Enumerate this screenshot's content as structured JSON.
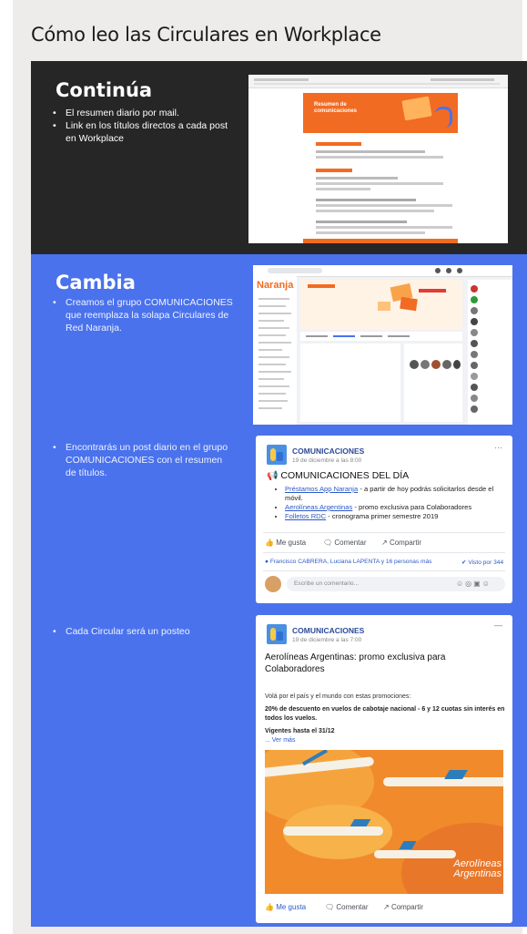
{
  "title": "Cómo leo las Circulares en Workplace",
  "section1": {
    "heading": "Continúa",
    "bullets": [
      "El resumen diario por mail.",
      "Link en los títulos directos a cada post en Workplace"
    ]
  },
  "section2": {
    "heading": "Cambia",
    "bullets": [
      "Creamos el grupo COMUNICACIONES que reemplaza la solapa Circulares de Red Naranja.",
      "Encontrarás un post diario en el grupo COMUNICACIONES con el resumen de títulos.",
      "Cada Circular será un posteo"
    ]
  },
  "email_shot": {
    "banner_title": "Resumen de comunicaciones"
  },
  "workplace_shot": {
    "brand": "Naranja"
  },
  "post1": {
    "group": "COMUNICACIONES",
    "date": "19 de diciembre a las 8:00",
    "heading": "COMUNICACIONES DEL DÍA",
    "items": [
      {
        "link": "Préstamos App Naranja",
        "text": " - a partir de hoy podrás solicitarlos desde el móvil."
      },
      {
        "link": "Aerolíneas Argentinas",
        "text": " - promo exclusiva para Colaboradores"
      },
      {
        "link": "Folletos RDC",
        "text": " - cronograma primer semestre 2019"
      }
    ],
    "like": "Me gusta",
    "comment": "Comentar",
    "share": "Compartir",
    "reactions": "Francisco CABRERA, Luciana LAPENTA y 16 personas más",
    "seen": "Visto por 344",
    "comment_placeholder": "Escribe un comentario..."
  },
  "post2": {
    "group": "COMUNICACIONES",
    "date": "19 de diciembre a las 7:00",
    "title": "Aerolíneas Argentinas: promo exclusiva para Colaboradores",
    "intro": "Volá por el país y el mundo con estas promociones:",
    "promo": "20% de descuento en vuelos de cabotaje nacional - 6 y 12 cuotas sin interés en todos los vuelos.",
    "valid": "Vigentes hasta el 31/12",
    "more": "... Ver más",
    "image_brand_1": "Aerolíneas",
    "image_brand_2": "Argentinas",
    "like": "Me gusta",
    "comment": "Comentar",
    "share": "Compartir"
  },
  "colors": {
    "dark_panel": "#262626",
    "blue_panel": "#4a72ec",
    "orange": "#f26b22",
    "link": "#2d59c8"
  }
}
